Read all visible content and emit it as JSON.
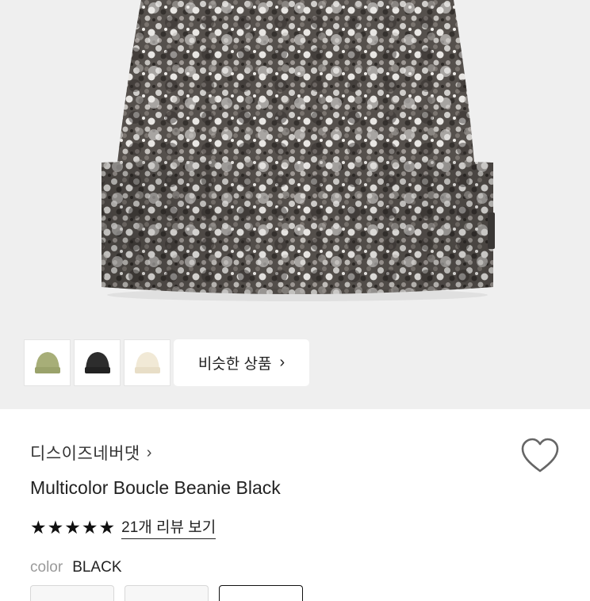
{
  "gallery": {
    "thumbnails": [
      {
        "name": "olive-beanie-thumbnail",
        "color": "#a8b07a"
      },
      {
        "name": "black-beanie-thumbnail",
        "color": "#2b2b2b"
      },
      {
        "name": "cream-beanie-thumbnail",
        "color": "#efe6d2"
      }
    ],
    "similar_label": "비슷한 상품",
    "similar_chevron": "›"
  },
  "product": {
    "brand": "디스이즈네버댓",
    "brand_chevron": "›",
    "title": "Multicolor Boucle Beanie Black",
    "rating_stars": 5,
    "reviews_label": "21개 리뷰 보기",
    "color_label": "color",
    "color_value": "BLACK"
  },
  "colors": {
    "hero_bg": "#efefef",
    "beanie_dark": "#4a4542",
    "beanie_light": "#d9d7d4"
  }
}
